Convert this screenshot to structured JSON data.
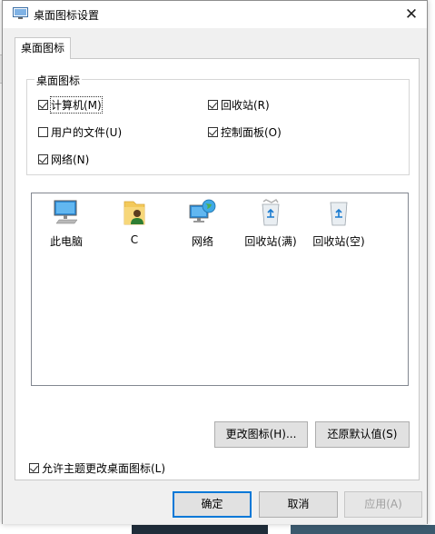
{
  "window": {
    "title": "桌面图标设置",
    "close_glyph": "✕"
  },
  "tab": {
    "label": "桌面图标"
  },
  "group": {
    "legend": "桌面图标"
  },
  "checkboxes": [
    {
      "label": "计算机(M)",
      "checked": true
    },
    {
      "label": "回收站(R)",
      "checked": true
    },
    {
      "label": "用户的文件(U)",
      "checked": false
    },
    {
      "label": "控制面板(O)",
      "checked": true
    },
    {
      "label": "网络(N)",
      "checked": true
    }
  ],
  "icons": [
    {
      "caption": "此电脑",
      "icon": "computer-icon"
    },
    {
      "caption": "C",
      "icon": "user-folder-icon"
    },
    {
      "caption": "网络",
      "icon": "network-icon"
    },
    {
      "caption": "回收站(满)",
      "icon": "recycle-bin-full-icon"
    },
    {
      "caption": "回收站(空)",
      "icon": "recycle-bin-empty-icon"
    }
  ],
  "buttons": {
    "change_icon": "更改图标(H)...",
    "restore_default": "还原默认值(S)",
    "ok": "确定",
    "cancel": "取消",
    "apply": "应用(A)"
  },
  "allow_themes": {
    "label": "允许主题更改桌面图标(L)",
    "checked": true
  },
  "colors": {
    "accent": "#0078d7",
    "dialog_bg": "#f0f0f0",
    "panel_bg": "#ffffff"
  }
}
